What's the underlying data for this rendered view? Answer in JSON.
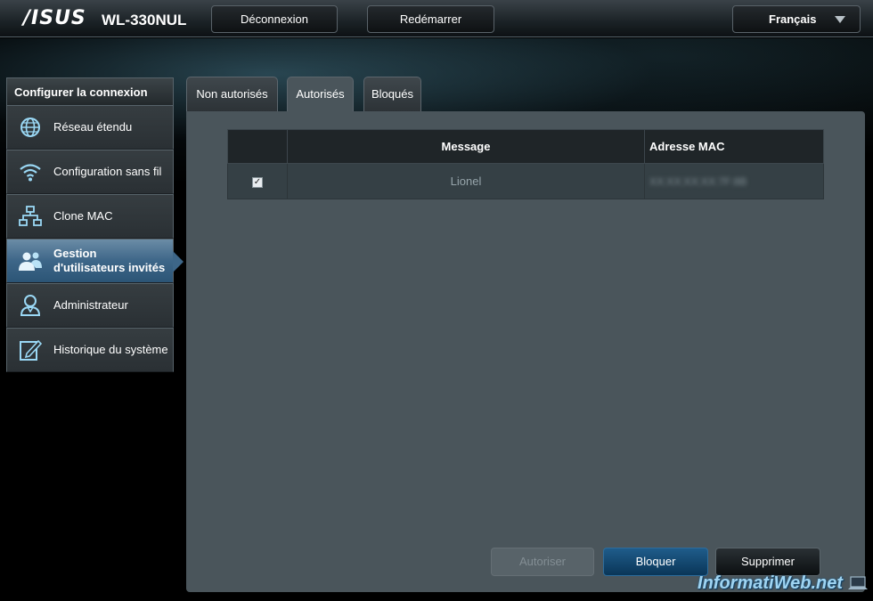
{
  "header": {
    "brand": "/ISUS",
    "model": "WL-330NUL",
    "logout_label": "Déconnexion",
    "reboot_label": "Redémarrer",
    "language": "Français"
  },
  "sidebar": {
    "title": "Configurer la connexion",
    "items": [
      {
        "label": "Réseau étendu",
        "icon": "globe-icon"
      },
      {
        "label": "Configuration sans fil",
        "icon": "wifi-icon"
      },
      {
        "label": "Clone MAC",
        "icon": "network-icon"
      },
      {
        "label": "Gestion d'utilisateurs invités",
        "icon": "users-icon",
        "active": true
      },
      {
        "label": "Administrateur",
        "icon": "admin-icon"
      },
      {
        "label": "Historique du système",
        "icon": "log-icon"
      }
    ]
  },
  "tabs": [
    {
      "label": "Non autorisés"
    },
    {
      "label": "Autorisés",
      "active": true
    },
    {
      "label": "Bloqués"
    }
  ],
  "table": {
    "headers": [
      "",
      "Message",
      "Adresse MAC"
    ],
    "rows": [
      {
        "checked": true,
        "message": "Lionel",
        "mac": "XX:XX:XX:XX:7F:8B"
      }
    ]
  },
  "actions": {
    "authorize_label": "Autoriser",
    "block_label": "Bloquer",
    "delete_label": "Supprimer"
  },
  "watermark": "InformatiWeb.net",
  "colors": {
    "accent": "#3d6688",
    "panel": "#4a555b",
    "block_button": "#1f5c8a"
  }
}
